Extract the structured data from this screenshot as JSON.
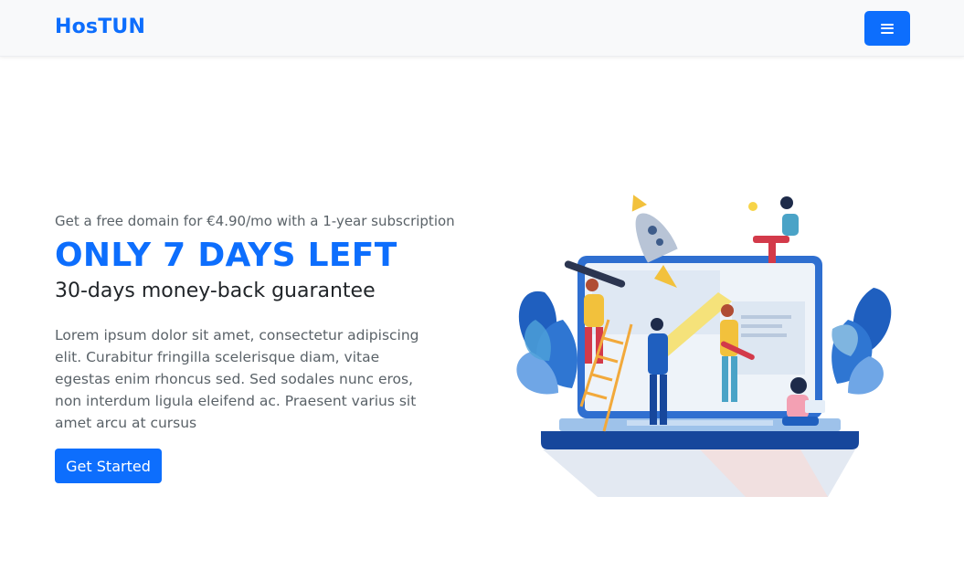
{
  "navbar": {
    "brand": "HosTUN",
    "menu_icon": "hamburger-menu-icon"
  },
  "hero": {
    "eyebrow": "Get a free domain for €4.90/mo with a 1-year subscription",
    "headline": "ONLY 7 DAYS LEFT",
    "subhead": "30-days money-back guarantee",
    "body": "Lorem ipsum dolor sit amet, consectetur adipiscing elit. Curabitur fringilla scelerisque diam, vitae egestas enim rhoncus sed. Sed sodales nunc eros, non interdum ligula eleifend ac. Praesent varius sit amet arcu at cursus",
    "cta_label": "Get Started",
    "illustration": "team-laptop-rocket-illustration"
  },
  "colors": {
    "primary": "#0d6efd",
    "text_muted": "#5a6268",
    "text_dark": "#212529",
    "navbar_bg": "#f8f9fa"
  }
}
